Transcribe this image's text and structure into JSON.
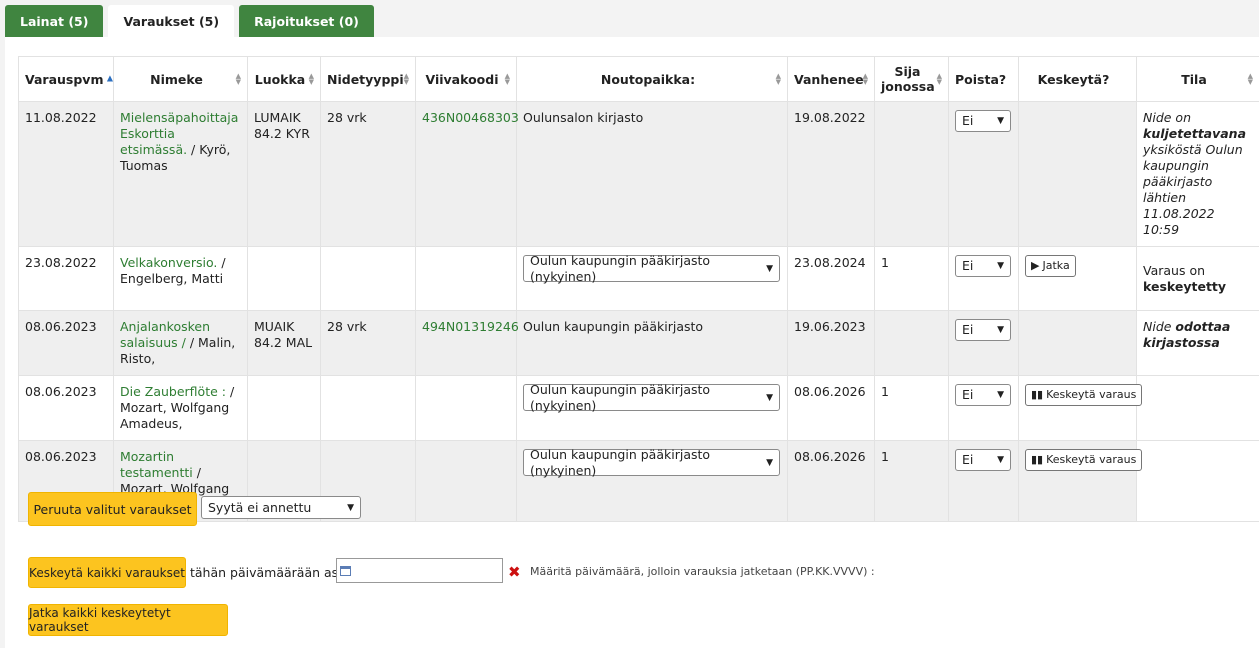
{
  "tabs": [
    {
      "label": "Lainat (5)"
    },
    {
      "label": "Varaukset (5)"
    },
    {
      "label": "Rajoitukset (0)"
    }
  ],
  "columns": {
    "varauspvm": "Varauspvm",
    "nimeke": "Nimeke",
    "luokka": "Luokka",
    "nidetyyppi": "Nidetyyppi",
    "viivakoodi": "Viivakoodi",
    "noutopaikka": "Noutopaikka:",
    "vanhenee": "Vanhenee",
    "sija": "Sija jonossa",
    "poista": "Poista?",
    "keskeyta": "Keskeytä?",
    "tila": "Tila"
  },
  "rows": [
    {
      "date": "11.08.2022",
      "title": "Mielensäpahoittaja Eskorttia etsimässä.",
      "author": " / Kyrö, Tuomas",
      "luokka": "LUMAIK 84.2 KYR",
      "nidetyyppi": "28 vrk",
      "barcode": "436N00468303",
      "pickup": "Oulunsalon kirjasto",
      "expires": "19.08.2022",
      "queue": "",
      "delete": "Ei",
      "tila_pre": "Nide on ",
      "tila_bold": "kuljetettavana",
      "tila_post": " yksiköstä Oulun kaupungin pääkirjasto lähtien 11.08.2022 10:59"
    },
    {
      "date": "23.08.2022",
      "title": "Velkakonversio.",
      "author": " / Engelberg, Matti",
      "pickup_select": "Oulun kaupungin pääkirjasto (nykyinen)",
      "expires": "23.08.2024",
      "queue": "1",
      "delete": "Ei",
      "suspend": "Jatka",
      "tila_pre": "Varaus on ",
      "tila_bold": "keskeytetty"
    },
    {
      "date": "08.06.2023",
      "title": "Anjalankosken salaisuus / ",
      "author": "/ Malin, Risto,",
      "luokka": "MUAIK 84.2 MAL",
      "nidetyyppi": "28 vrk",
      "barcode": "494N01319246",
      "pickup": "Oulun kaupungin pääkirjasto",
      "expires": "19.06.2023",
      "queue": "",
      "delete": "Ei",
      "tila_pre": "Nide ",
      "tila_bold": "odottaa kirjastossa"
    },
    {
      "date": "08.06.2023",
      "title": "Die Zauberflöte :",
      "author": " / Mozart, Wolfgang Amadeus,",
      "pickup_select": "Oulun kaupungin pääkirjasto (nykyinen)",
      "expires": "08.06.2026",
      "queue": "1",
      "delete": "Ei",
      "suspend": "Keskeytä varaus"
    },
    {
      "date": "08.06.2023",
      "title": "Mozartin testamentti",
      "author": " / Mozart, Wolfgang Amadeus,",
      "pickup_select": "Oulun kaupungin pääkirjasto (nykyinen)",
      "expires": "08.06.2026",
      "queue": "1",
      "delete": "Ei",
      "suspend": "Keskeytä varaus"
    }
  ],
  "actions": {
    "cancel_selected": "Peruuta valitut varaukset",
    "reason": "Syytä ei annettu",
    "suspend_all": "Keskeytä kaikki varaukset",
    "until_label": "tähän päivämäärään asti",
    "date_value": "",
    "date_hint": "Määritä päivämäärä, jolloin varauksia jatketaan (PP.KK.VVVV) :",
    "resume_all": "Jatka kaikki keskeytetyt varaukset"
  },
  "colors": {
    "tab_green": "#408540",
    "link_green": "#2e7d32",
    "button_yellow": "#fcc41f",
    "clear_red": "#cc1010"
  }
}
